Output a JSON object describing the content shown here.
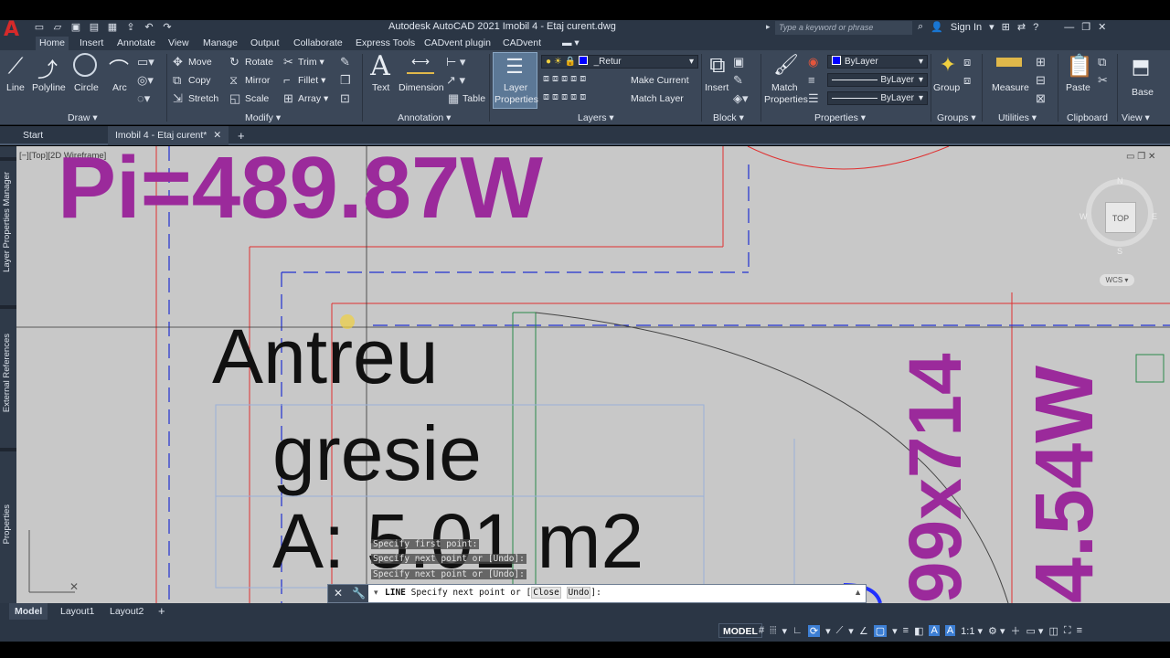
{
  "app": {
    "logo": "A",
    "title": "Autodesk AutoCAD 2021    Imobil 4 - Etaj curent.dwg",
    "search_placeholder": "Type a keyword or phrase",
    "sign_in": "Sign In"
  },
  "ribbon_tabs": [
    "Home",
    "Insert",
    "Annotate",
    "View",
    "Manage",
    "Output",
    "Collaborate",
    "Express Tools",
    "CADvent plugin",
    "CADvent"
  ],
  "ribbon": {
    "draw": {
      "title": "Draw",
      "line": "Line",
      "polyline": "Polyline",
      "circle": "Circle",
      "arc": "Arc"
    },
    "modify": {
      "title": "Modify",
      "move": "Move",
      "rotate": "Rotate",
      "trim": "Trim",
      "copy": "Copy",
      "mirror": "Mirror",
      "fillet": "Fillet",
      "stretch": "Stretch",
      "scale": "Scale",
      "array": "Array"
    },
    "annotation": {
      "title": "Annotation",
      "text": "Text",
      "dimension": "Dimension",
      "table": "Table"
    },
    "layers": {
      "title": "Layers",
      "layer_properties_1": "Layer",
      "layer_properties_2": "Properties",
      "current_layer": "_Retur",
      "make_current": "Make Current",
      "match_layer": "Match Layer",
      "layer_color": "#0000ff"
    },
    "block": {
      "title": "Block",
      "insert": "Insert"
    },
    "properties": {
      "title": "Properties",
      "match_1": "Match",
      "match_2": "Properties",
      "color": "ByLayer",
      "linetype": "ByLayer",
      "lineweight": "ByLayer"
    },
    "groups": {
      "title": "Groups",
      "group": "Group"
    },
    "utilities": {
      "title": "Utilities",
      "measure": "Measure"
    },
    "clipboard": {
      "title": "Clipboard",
      "paste": "Paste"
    },
    "view": {
      "title": "View",
      "base": "Base"
    }
  },
  "file_tabs": {
    "start": "Start",
    "active": "Imobil 4 - Etaj curent*",
    "close": "✕",
    "add": "+"
  },
  "palettes": [
    "Layer Properties Manager",
    "External References",
    "Properties"
  ],
  "viewport": {
    "label": "[−][Top][2D Wireframe]",
    "compass_n": "N",
    "compass_s": "S",
    "compass_e": "E",
    "compass_w": "W",
    "cube_face": "TOP",
    "wcs": "WCS"
  },
  "drawing": {
    "power_top": "Pi=489.87W",
    "room_name": "Antreu",
    "floor": "gresie",
    "area": "A: 5.01 m2",
    "vert_dim": "99x714",
    "vert_power": "4.54W"
  },
  "command": {
    "history": [
      "Specify first point:",
      "Specify next point or [Undo]:",
      "Specify next point or [Undo]:"
    ],
    "prompt_cmd": "LINE",
    "prompt_text": "Specify next point or [",
    "opt_close": "Close",
    "opt_undo": "Undo",
    "prompt_end": "]:"
  },
  "layout_tabs": [
    "Model",
    "Layout1",
    "Layout2"
  ],
  "status": {
    "model": "MODEL",
    "scale": "1:1"
  }
}
